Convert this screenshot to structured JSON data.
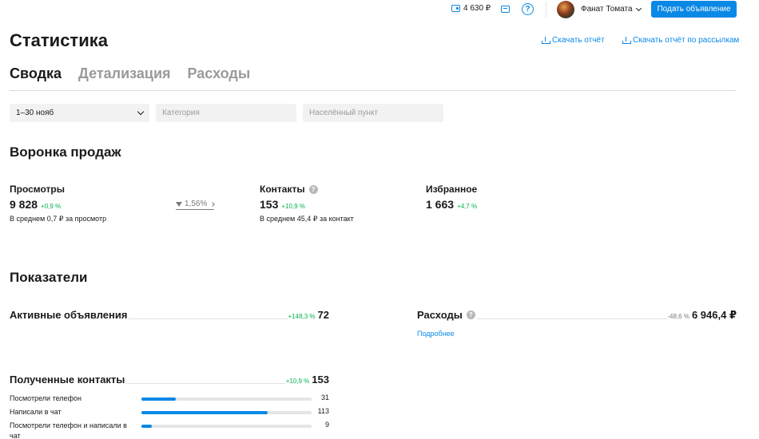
{
  "topbar": {
    "balance": "4 630 ₽",
    "user_name": "Фанат Томата",
    "post_button": "Подать объявление"
  },
  "page": {
    "title": "Статистика",
    "download_report": "Скачать отчёт",
    "download_mailing_report": "Скачать отчёт по рассылкам"
  },
  "tabs": [
    {
      "label": "Сводка",
      "active": true
    },
    {
      "label": "Детализация",
      "active": false
    },
    {
      "label": "Расходы",
      "active": false
    }
  ],
  "filters": {
    "period": "1–30 нояб",
    "category_placeholder": "Категория",
    "location_placeholder": "Населённый пункт"
  },
  "funnel": {
    "title": "Воронка продаж",
    "views": {
      "label": "Просмотры",
      "value": "9 828",
      "delta": "+0,9 %",
      "sub": "В среднем 0,7 ₽ за просмотр"
    },
    "conversion": "1,56%",
    "contacts": {
      "label": "Контакты",
      "value": "153",
      "delta": "+10,9 %",
      "sub": "В среднем 45,4 ₽ за контакт"
    },
    "favorites": {
      "label": "Избранное",
      "value": "1 663",
      "delta": "+4,7 %"
    }
  },
  "indicators": {
    "title": "Показатели",
    "active_ads": {
      "label": "Активные объявления",
      "delta": "+148,3 %",
      "value": "72"
    },
    "expenses": {
      "label": "Расходы",
      "delta": "-48,6 %",
      "value": "6 946,4 ₽",
      "more": "Подробнее"
    },
    "received_contacts": {
      "label": "Полученные контакты",
      "delta": "+10,9 %",
      "value": "153"
    }
  },
  "contact_breakdown": [
    {
      "label": "Посмотрели телефон",
      "count": "31",
      "fraction": 0.2
    },
    {
      "label": "Написали в чат",
      "count": "113",
      "fraction": 0.74
    },
    {
      "label": "Посмотрели телефон и написали в чат",
      "count": "9",
      "fraction": 0.06
    }
  ],
  "colors": {
    "accent": "#0a88e6",
    "positive": "#04b34b",
    "muted": "#9a9a9a"
  }
}
